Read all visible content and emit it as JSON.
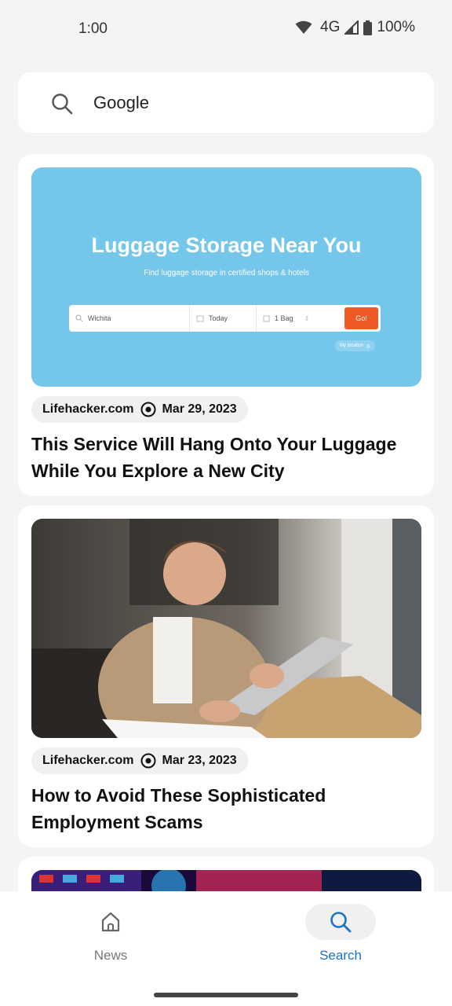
{
  "status_bar": {
    "time": "1:00",
    "network": "4G",
    "battery": "100%"
  },
  "search": {
    "query": "Google"
  },
  "articles": [
    {
      "source": "Lifehacker.com",
      "date": "Mar 29, 2023",
      "title": "This Service Will Hang Onto Your Luggage While You Explore a New City",
      "image": {
        "headline": "Luggage Storage Near You",
        "subline": "Find luggage storage in certified shops & hotels",
        "location_field": "Wichita",
        "date_field": "Today",
        "bags_field": "1 Bag",
        "go_button": "Go!",
        "my_location": "My location"
      }
    },
    {
      "source": "Lifehacker.com",
      "date": "Mar 23, 2023",
      "title": "How to Avoid These Sophisticated Employment Scams"
    }
  ],
  "nav": {
    "news_label": "News",
    "search_label": "Search"
  },
  "colors": {
    "accent": "#1a73c8",
    "luggage_bg": "#74c6eb",
    "go_button": "#ee5a24"
  }
}
